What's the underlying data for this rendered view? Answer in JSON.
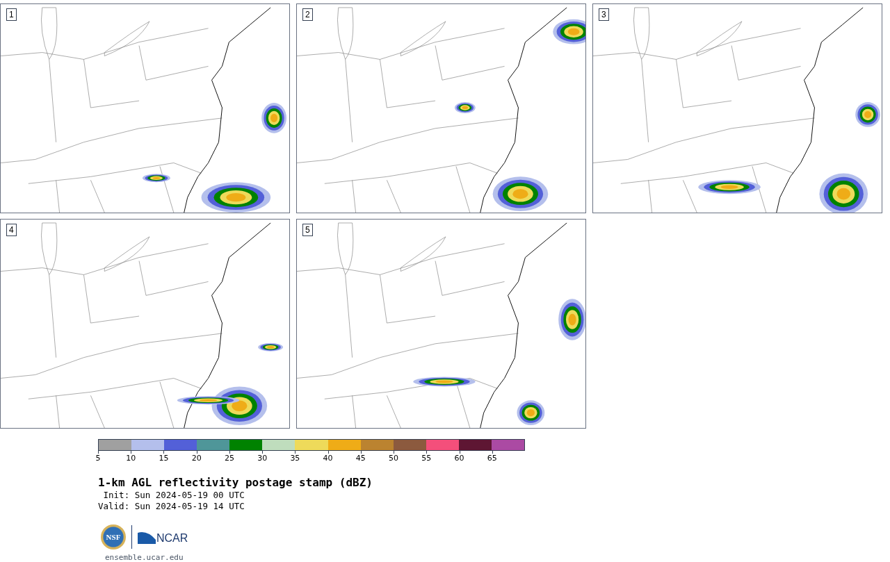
{
  "panels": [
    {
      "label": "1"
    },
    {
      "label": "2"
    },
    {
      "label": "3"
    },
    {
      "label": "4"
    },
    {
      "label": "5"
    }
  ],
  "colorbar": {
    "segments": [
      {
        "color": "#a0a0a0"
      },
      {
        "color": "#b4bfec"
      },
      {
        "color": "#5360d8"
      },
      {
        "color": "#4f9699"
      },
      {
        "color": "#008200"
      },
      {
        "color": "#bfddbd"
      },
      {
        "color": "#eeda5a"
      },
      {
        "color": "#efac17"
      },
      {
        "color": "#bb8330"
      },
      {
        "color": "#8c5a3e"
      },
      {
        "color": "#f44f7b"
      },
      {
        "color": "#5e1633"
      },
      {
        "color": "#ab4aa3"
      }
    ],
    "ticks": [
      "5",
      "10",
      "15",
      "20",
      "25",
      "30",
      "35",
      "40",
      "45",
      "50",
      "55",
      "60",
      "65"
    ]
  },
  "title": "1-km AGL reflectivity postage stamp (dBZ)",
  "init": " Init: Sun 2024-05-19 00 UTC",
  "valid": "Valid: Sun 2024-05-19 14 UTC",
  "logos": {
    "nsf": "NSF",
    "ncar": "NCAR"
  },
  "footer": "ensemble.ucar.edu"
}
